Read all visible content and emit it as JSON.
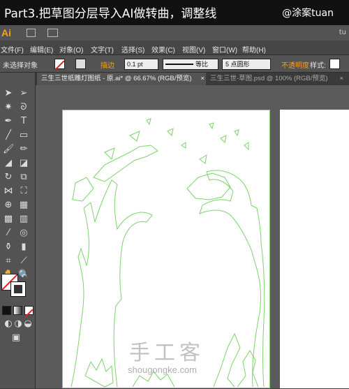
{
  "banner": {
    "title": "Part3.把草图分层导入AI做转曲，调整线",
    "watermark": "@涂案tuan"
  },
  "app": {
    "logo": "Ai",
    "right_text": "tu"
  },
  "menu": {
    "items": [
      "文件(F)",
      "编辑(E)",
      "对象(O)",
      "文字(T)",
      "选择(S)",
      "效果(C)",
      "视图(V)",
      "窗口(W)",
      "帮助(H)"
    ]
  },
  "control": {
    "no_selection": "未选择对象",
    "stroke_label": "描边",
    "stroke_value": "0.1 pt",
    "line_style": "等比",
    "brush": "5 点圆形",
    "opacity_label": "不透明度",
    "style_label": "样式:"
  },
  "tabs": [
    {
      "label": "三生三世纸雕灯图纸 - 原.ai* @ 66.67% (RGB/预览)",
      "close": "×"
    },
    {
      "label": "三生三世-草图.psd @ 100% (RGB/预览)",
      "close": "×"
    }
  ],
  "watermarks": {
    "site_cn": "手工客",
    "site_en": "shougongke.com"
  },
  "colors": {
    "outline": "#7cd36b",
    "accent": "#f7a21c"
  }
}
